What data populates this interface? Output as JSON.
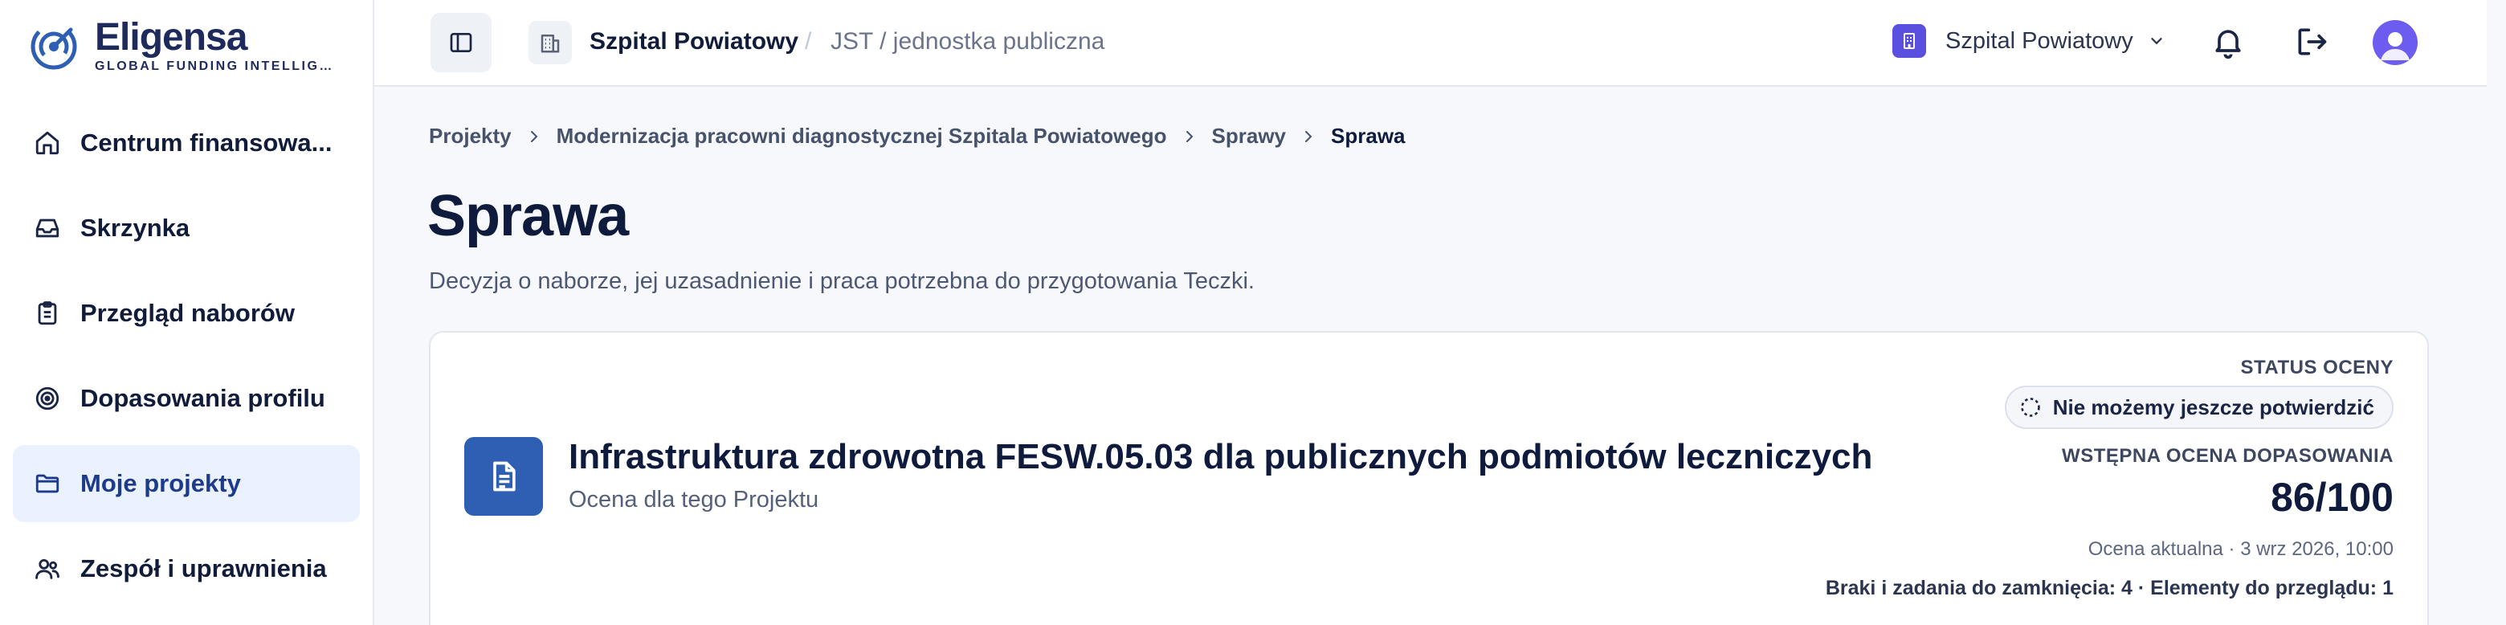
{
  "brand": {
    "name": "Eligensa",
    "tagline": "GLOBAL FUNDING INTELLIGEN..."
  },
  "sidebar": {
    "items": [
      {
        "label": "Centrum finansowa...",
        "icon": "home-icon"
      },
      {
        "label": "Skrzynka",
        "icon": "inbox-icon"
      },
      {
        "label": "Przegląd naborów",
        "icon": "clipboard-icon"
      },
      {
        "label": "Dopasowania profilu",
        "icon": "target-icon"
      },
      {
        "label": "Moje projekty",
        "icon": "folder-icon",
        "active": true
      },
      {
        "label": "Zespół i uprawnienia",
        "icon": "users-icon"
      }
    ]
  },
  "topbar": {
    "org_name": "Szpital Powiatowy",
    "separator": "/",
    "org_type": "JST / jednostka publiczna",
    "org_switcher": "Szpital Powiatowy"
  },
  "breadcrumb": {
    "items": [
      "Projekty",
      "Modernizacja pracowni diagnostycznej Szpitala Powiatowego",
      "Sprawy",
      "Sprawa"
    ]
  },
  "page": {
    "title": "Sprawa",
    "subtitle": "Decyzja o naborze, jej uzasadnienie i praca potrzebna do przygotowania Teczki."
  },
  "card": {
    "title": "Infrastruktura zdrowotna FESW.05.03 dla publicznych podmiotów leczniczych",
    "subtitle": "Ocena dla tego Projektu",
    "status_label": "STATUS OCENY",
    "status_value": "Nie możemy jeszcze potwierdzić",
    "fit_label": "WSTĘPNA OCENA DOPASOWANIA",
    "score": "86/100",
    "updated": "Ocena aktualna · 3 wrz 2026, 10:00",
    "gaps": "Braki i zadania do zamknięcia: 4 · Elementy do przeglądu: 1"
  },
  "colors": {
    "accent": "#2f5fb3",
    "active_nav_bg": "#eaf1ff",
    "org_badge": "#5b4fe0",
    "avatar": "#6d5cf0"
  }
}
